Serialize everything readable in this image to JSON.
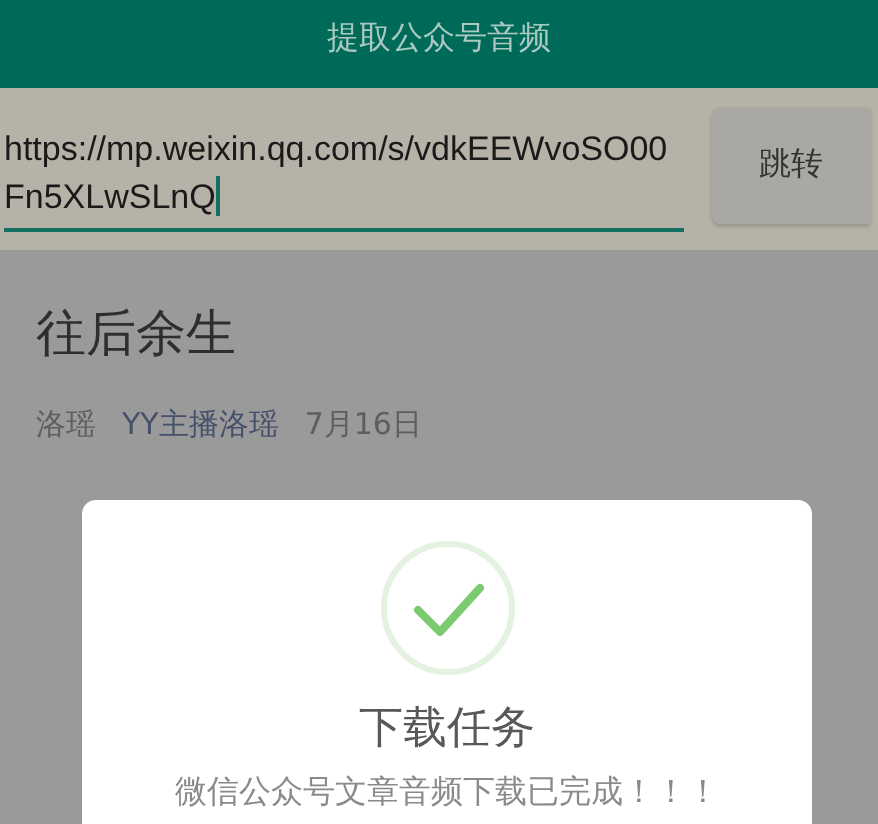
{
  "app_bar": {
    "title": "提取公众号音频"
  },
  "url_bar": {
    "value": "https://mp.weixin.qq.com/s/vdkEEWvoSO00Fn5XLwSLnQ",
    "button": "跳转"
  },
  "article": {
    "title": "往后余生",
    "author": "洛瑶",
    "account": "YY主播洛瑶",
    "date": "7月16日"
  },
  "dialog": {
    "title": "下载任务",
    "message": "微信公众号文章音频下载已完成！！！"
  }
}
